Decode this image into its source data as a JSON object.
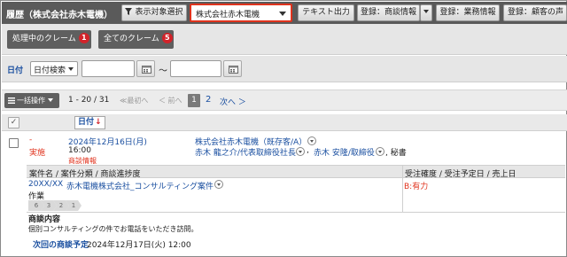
{
  "header": {
    "title": "履歴（株式会社赤木電機）",
    "filter_button": "表示対象選択",
    "company_select_value": "株式会社赤木電機",
    "text_output_button": "テキスト出力",
    "register_deal_button": "登録：商談情報",
    "register_business_button": "登録：業務情報",
    "register_voice_button": "登録：顧客の声"
  },
  "tabs": [
    {
      "label": "処理中のクレーム",
      "count": "1"
    },
    {
      "label": "全てのクレーム",
      "count": "5"
    }
  ],
  "date_filter": {
    "label": "日付",
    "select_value": "日付検索",
    "separator": "〜",
    "from_value": "",
    "to_value": ""
  },
  "pager": {
    "bulk_label": "一括操作",
    "range": "1 - 20 / 31",
    "first": "≪最初へ",
    "prev": "＜ 前へ",
    "current_page": "1",
    "page2": "2",
    "next": "次へ ＞"
  },
  "table": {
    "check_symbol": "✓",
    "sort_label": "日付",
    "sort_arrow": "↓"
  },
  "row": {
    "dash": "-",
    "status": "実施",
    "date": "2024年12月16日(月)",
    "time": "16:00",
    "deal_info": "商談情報",
    "company": "株式会社赤木電機（既存客/A）",
    "contact1": "赤木 龍之介/代表取締役社長",
    "sep": ",",
    "contact2": "赤木 安隆/取締役",
    "secretary": ", 秘書"
  },
  "deal": {
    "header_left": "案件名 / 案件分類 / 商談進捗度",
    "header_right": "受注確度 / 受注予定日 / 売上日",
    "code": "20XX/XX",
    "name": "赤木電機株式会社_コンサルティング案件",
    "category": "作業",
    "stages": [
      "6",
      "3",
      "2",
      "1"
    ],
    "probability": "B:有力"
  },
  "notes": {
    "label": "商談内容",
    "text": "個別コンサルティングの件でお電話をいただき訪問。",
    "next_label": "次回の商談予定",
    "next_value": "2024年12月17日(火) 12:00"
  }
}
